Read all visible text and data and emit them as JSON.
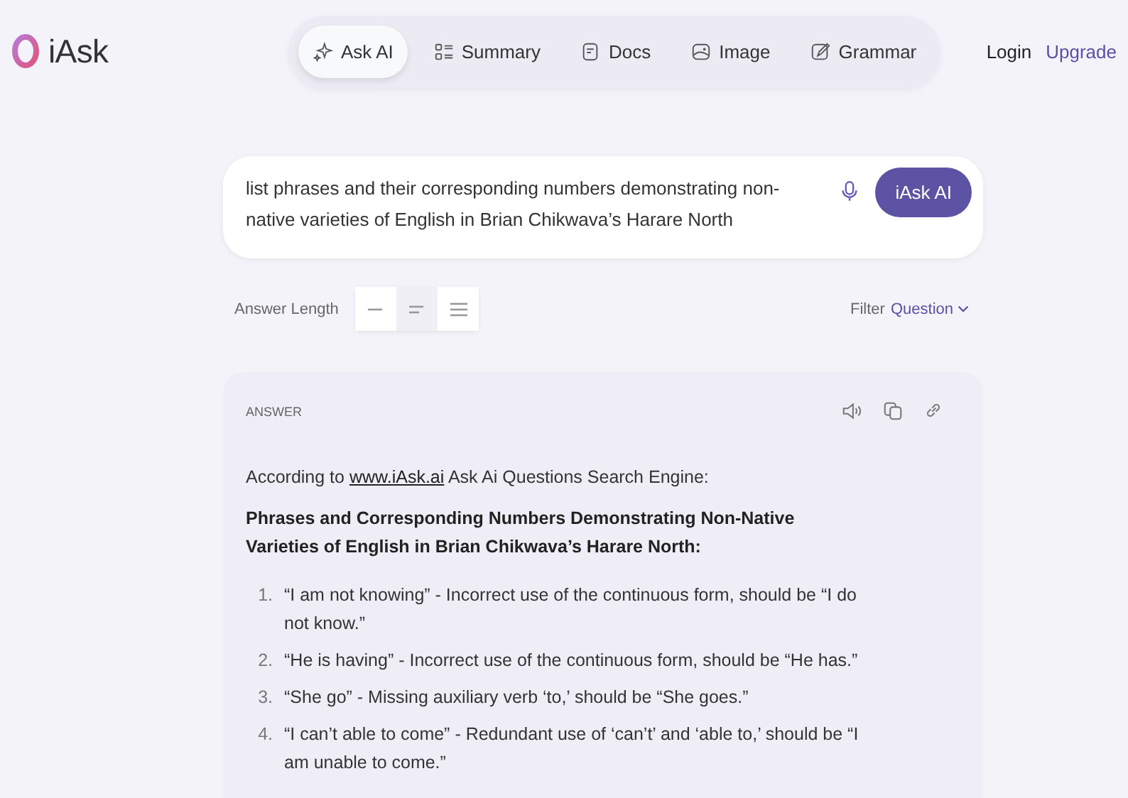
{
  "brand": {
    "name": "iAsk"
  },
  "nav": [
    {
      "label": "Ask AI",
      "selected": true
    },
    {
      "label": "Summary",
      "selected": false
    },
    {
      "label": "Docs",
      "selected": false
    },
    {
      "label": "Image",
      "selected": false
    },
    {
      "label": "Grammar",
      "selected": false
    }
  ],
  "account": {
    "login": "Login",
    "upgrade": "Upgrade"
  },
  "search": {
    "value": "list phrases and their corresponding numbers demonstrating non-native varieties of English in Brian Chikwava’s Harare North",
    "button": "iAsk AI"
  },
  "answer_length": {
    "label": "Answer Length",
    "options": [
      {
        "selected": false
      },
      {
        "selected": true
      },
      {
        "selected": false
      }
    ]
  },
  "filter": {
    "label": "Filter",
    "value": "Question"
  },
  "answer": {
    "heading": "ANSWER",
    "intro": {
      "before": "According to",
      "link": "www.iAsk.ai",
      "after": "Ask Ai Questions Search Engine:"
    },
    "title": "Phrases and Corresponding Numbers Demonstrating Non-Native Varieties of English in Brian Chikwava’s Harare North:",
    "items": [
      {
        "number": "1.",
        "text": "“I am not knowing” - Incorrect use of the continuous form, should be “I do not know.”"
      },
      {
        "number": "2.",
        "text": "“He is having” - Incorrect use of the continuous form, should be “He has.”"
      },
      {
        "number": "3.",
        "text": "“She go” - Missing auxiliary verb ‘to,’ should be “She goes.”"
      },
      {
        "number": "4.",
        "text": "“I can’t able to come” - Redundant use of ‘can’t’ and ‘able to,’ should be “I am unable to come.”"
      }
    ]
  }
}
